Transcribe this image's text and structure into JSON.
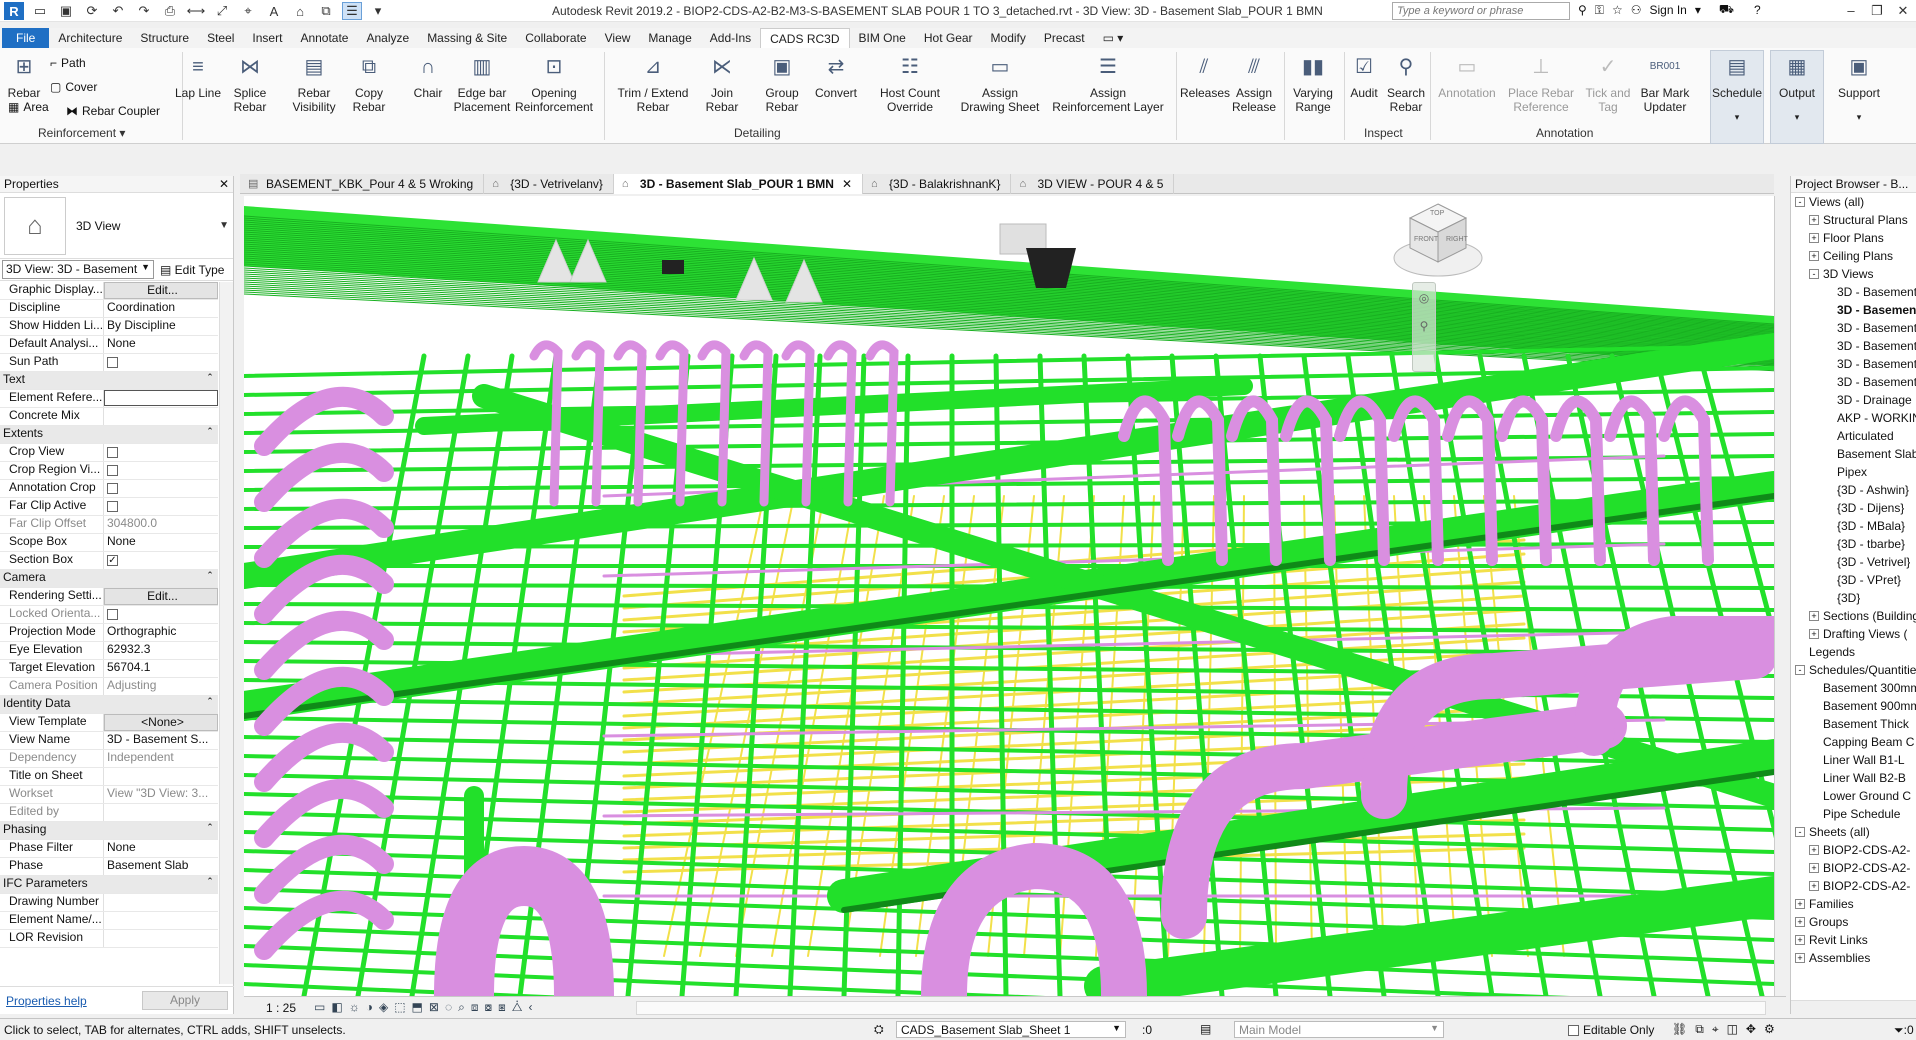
{
  "window": {
    "title": "Autodesk Revit 2019.2 - BIOP2-CDS-A2-B2-M3-S-BASEMENT SLAB POUR 1 TO 3_detached.rvt - 3D View: 3D - Basement Slab_POUR 1 BMN",
    "search_placeholder": "Type a keyword or phrase",
    "sign_in": "Sign In"
  },
  "ribbon_tabs": [
    "File",
    "Architecture",
    "Structure",
    "Steel",
    "Insert",
    "Annotate",
    "Analyze",
    "Massing & Site",
    "Collaborate",
    "View",
    "Manage",
    "Add-Ins",
    "CADS RC3D",
    "BIM One",
    "Hot Gear",
    "Modify",
    "Precast"
  ],
  "ribbon": {
    "rebar": "Rebar",
    "path": "Path",
    "cover": "Cover",
    "area": "Area",
    "rebar_coupler": "Rebar Coupler",
    "reinforcement_panel": "Reinforcement",
    "lap_line": "Lap Line",
    "splice_rebar": "Splice\nRebar",
    "rebar_visibility": "Rebar\nVisibility",
    "copy_rebar": "Copy\nRebar",
    "chair": "Chair",
    "edge_bar_placement": "Edge bar\nPlacement",
    "opening_reinforcement": "Opening\nReinforcement",
    "trim_extend_rebar": "Trim / Extend\nRebar",
    "join_rebar": "Join\nRebar",
    "group_rebar": "Group\nRebar",
    "convert": "Convert",
    "host_count_override": "Host Count\nOverride",
    "assign_drawing_sheet": "Assign\nDrawing Sheet",
    "assign_reinforcement_layer": "Assign\nReinforcement Layer",
    "detailing_panel": "Detailing",
    "releases": "Releases",
    "assign_release": "Assign\nRelease",
    "varying_range": "Varying\nRange",
    "audit": "Audit",
    "search_rebar": "Search\nRebar",
    "inspect_panel": "Inspect",
    "annotation": "Annotation",
    "place_rebar_reference": "Place Rebar\nReference",
    "tick_and_tag": "Tick and\nTag",
    "bar_mark_updater": "Bar Mark\nUpdater",
    "bar_mark_icon_text": "BR001",
    "annotation_panel": "Annotation",
    "schedule": "Schedule",
    "output": "Output",
    "support": "Support"
  },
  "properties": {
    "header": "Properties",
    "type_name": "3D View",
    "instance_selector": "3D View: 3D - Basement",
    "edit_type": "Edit Type",
    "rows": [
      {
        "section": "",
        "k": "Graphic Display...",
        "v": "Edit...",
        "kind": "button"
      },
      {
        "k": "Discipline",
        "v": "Coordination"
      },
      {
        "k": "Show Hidden Li...",
        "v": "By Discipline"
      },
      {
        "k": "Default Analysi...",
        "v": "None"
      },
      {
        "k": "Sun Path",
        "v": "",
        "kind": "check",
        "checked": false
      },
      {
        "section_title": "Text"
      },
      {
        "k": "Element Refere...",
        "v": "",
        "kind": "input"
      },
      {
        "k": "Concrete Mix",
        "v": ""
      },
      {
        "section_title": "Extents"
      },
      {
        "k": "Crop View",
        "v": "",
        "kind": "check",
        "checked": false
      },
      {
        "k": "Crop Region Vi...",
        "v": "",
        "kind": "check",
        "checked": false
      },
      {
        "k": "Annotation Crop",
        "v": "",
        "kind": "check",
        "checked": false
      },
      {
        "k": "Far Clip Active",
        "v": "",
        "kind": "check",
        "checked": false
      },
      {
        "k": "Far Clip Offset",
        "v": "304800.0",
        "ro": true
      },
      {
        "k": "Scope Box",
        "v": "None"
      },
      {
        "k": "Section Box",
        "v": "",
        "kind": "check",
        "checked": true
      },
      {
        "section_title": "Camera"
      },
      {
        "k": "Rendering Setti...",
        "v": "Edit...",
        "kind": "button"
      },
      {
        "k": "Locked Orienta...",
        "v": "",
        "kind": "check",
        "checked": false,
        "ro": true
      },
      {
        "k": "Projection Mode",
        "v": "Orthographic"
      },
      {
        "k": "Eye Elevation",
        "v": "62932.3"
      },
      {
        "k": "Target Elevation",
        "v": "56704.1"
      },
      {
        "k": "Camera Position",
        "v": "Adjusting",
        "ro": true
      },
      {
        "section_title": "Identity Data"
      },
      {
        "k": "View Template",
        "v": "<None>",
        "kind": "button"
      },
      {
        "k": "View Name",
        "v": "3D - Basement S..."
      },
      {
        "k": "Dependency",
        "v": "Independent",
        "ro": true
      },
      {
        "k": "Title on Sheet",
        "v": ""
      },
      {
        "k": "Workset",
        "v": "View \"3D View: 3...",
        "ro": true
      },
      {
        "k": "Edited by",
        "v": "",
        "ro": true
      },
      {
        "section_title": "Phasing"
      },
      {
        "k": "Phase Filter",
        "v": "None"
      },
      {
        "k": "Phase",
        "v": "Basement Slab"
      },
      {
        "section_title": "IFC Parameters"
      },
      {
        "k": "Drawing Number",
        "v": ""
      },
      {
        "k": "Element Name/...",
        "v": ""
      },
      {
        "k": "LOR Revision",
        "v": ""
      }
    ],
    "help_link": "Properties help",
    "apply": "Apply"
  },
  "view_tabs": [
    {
      "label": "BASEMENT_KBK_Pour 4 & 5 Wroking",
      "active": false
    },
    {
      "label": "{3D - Vetrivelanv}",
      "active": false
    },
    {
      "label": "3D - Basement Slab_POUR 1 BMN",
      "active": true
    },
    {
      "label": "{3D - BalakrishnanK}",
      "active": false
    },
    {
      "label": "3D VIEW - POUR 4 & 5",
      "active": false
    }
  ],
  "viewcube": {
    "top": "TOP",
    "front": "FRONT",
    "right": "RIGHT"
  },
  "view_control": {
    "scale": "1 : 25"
  },
  "project_browser": {
    "header": "Project Browser - B...",
    "nodes": [
      {
        "label": "Views (all)",
        "indent": 0,
        "toggle": "-"
      },
      {
        "label": "Structural Plans",
        "indent": 1,
        "toggle": "+"
      },
      {
        "label": "Floor Plans",
        "indent": 1,
        "toggle": "+"
      },
      {
        "label": "Ceiling Plans",
        "indent": 1,
        "toggle": "+"
      },
      {
        "label": "3D Views",
        "indent": 1,
        "toggle": "-"
      },
      {
        "label": "3D - Basement",
        "indent": 2
      },
      {
        "label": "3D - Basement",
        "indent": 2,
        "bold": true
      },
      {
        "label": "3D - Basement",
        "indent": 2
      },
      {
        "label": "3D - Basement",
        "indent": 2
      },
      {
        "label": "3D - Basement",
        "indent": 2
      },
      {
        "label": "3D - Basement",
        "indent": 2
      },
      {
        "label": "3D - Drainage",
        "indent": 2
      },
      {
        "label": "AKP - WORKING",
        "indent": 2
      },
      {
        "label": "Articulated",
        "indent": 2
      },
      {
        "label": "Basement Slab",
        "indent": 2
      },
      {
        "label": "Pipex",
        "indent": 2
      },
      {
        "label": "{3D - Ashwin}",
        "indent": 2
      },
      {
        "label": "{3D - Dijens}",
        "indent": 2
      },
      {
        "label": "{3D - MBala}",
        "indent": 2
      },
      {
        "label": "{3D - tbarbe}",
        "indent": 2
      },
      {
        "label": "{3D - Vetrivel}",
        "indent": 2
      },
      {
        "label": "{3D - VPret}",
        "indent": 2
      },
      {
        "label": "{3D}",
        "indent": 2
      },
      {
        "label": "Sections (Building)",
        "indent": 1,
        "toggle": "+"
      },
      {
        "label": "Drafting Views (",
        "indent": 1,
        "toggle": "+"
      },
      {
        "label": "Legends",
        "indent": 0,
        "toggle": ""
      },
      {
        "label": "Schedules/Quantities",
        "indent": 0,
        "toggle": "-"
      },
      {
        "label": "Basement 300mm",
        "indent": 1
      },
      {
        "label": "Basement 900mm",
        "indent": 1
      },
      {
        "label": "Basement Thick",
        "indent": 1
      },
      {
        "label": "Capping Beam C",
        "indent": 1
      },
      {
        "label": "Liner Wall B1-L",
        "indent": 1
      },
      {
        "label": "Liner Wall B2-B",
        "indent": 1
      },
      {
        "label": "Lower Ground C",
        "indent": 1
      },
      {
        "label": "Pipe Schedule",
        "indent": 1
      },
      {
        "label": "Sheets (all)",
        "indent": 0,
        "toggle": "-"
      },
      {
        "label": "BIOP2-CDS-A2-",
        "indent": 1,
        "toggle": "+"
      },
      {
        "label": "BIOP2-CDS-A2-",
        "indent": 1,
        "toggle": "+"
      },
      {
        "label": "BIOP2-CDS-A2-",
        "indent": 1,
        "toggle": "+"
      },
      {
        "label": "Families",
        "indent": 0,
        "toggle": "+"
      },
      {
        "label": "Groups",
        "indent": 0,
        "toggle": "+"
      },
      {
        "label": "Revit Links",
        "indent": 0,
        "toggle": "+"
      },
      {
        "label": "Assemblies",
        "indent": 0,
        "toggle": "+"
      }
    ]
  },
  "status_bar": {
    "message": "Click to select, TAB for alternates, CTRL adds, SHIFT unselects.",
    "sheet": "CADS_Basement Slab_Sheet 1",
    "zero": ":0",
    "model": "Main Model",
    "editable_only": "Editable Only",
    "filter": ":0"
  },
  "colors": {
    "rebar_green": "#22e02a",
    "rebar_pink": "#d98fe0",
    "rebar_yellow": "#f2e04a",
    "file_tab": "#1f6fc4"
  }
}
